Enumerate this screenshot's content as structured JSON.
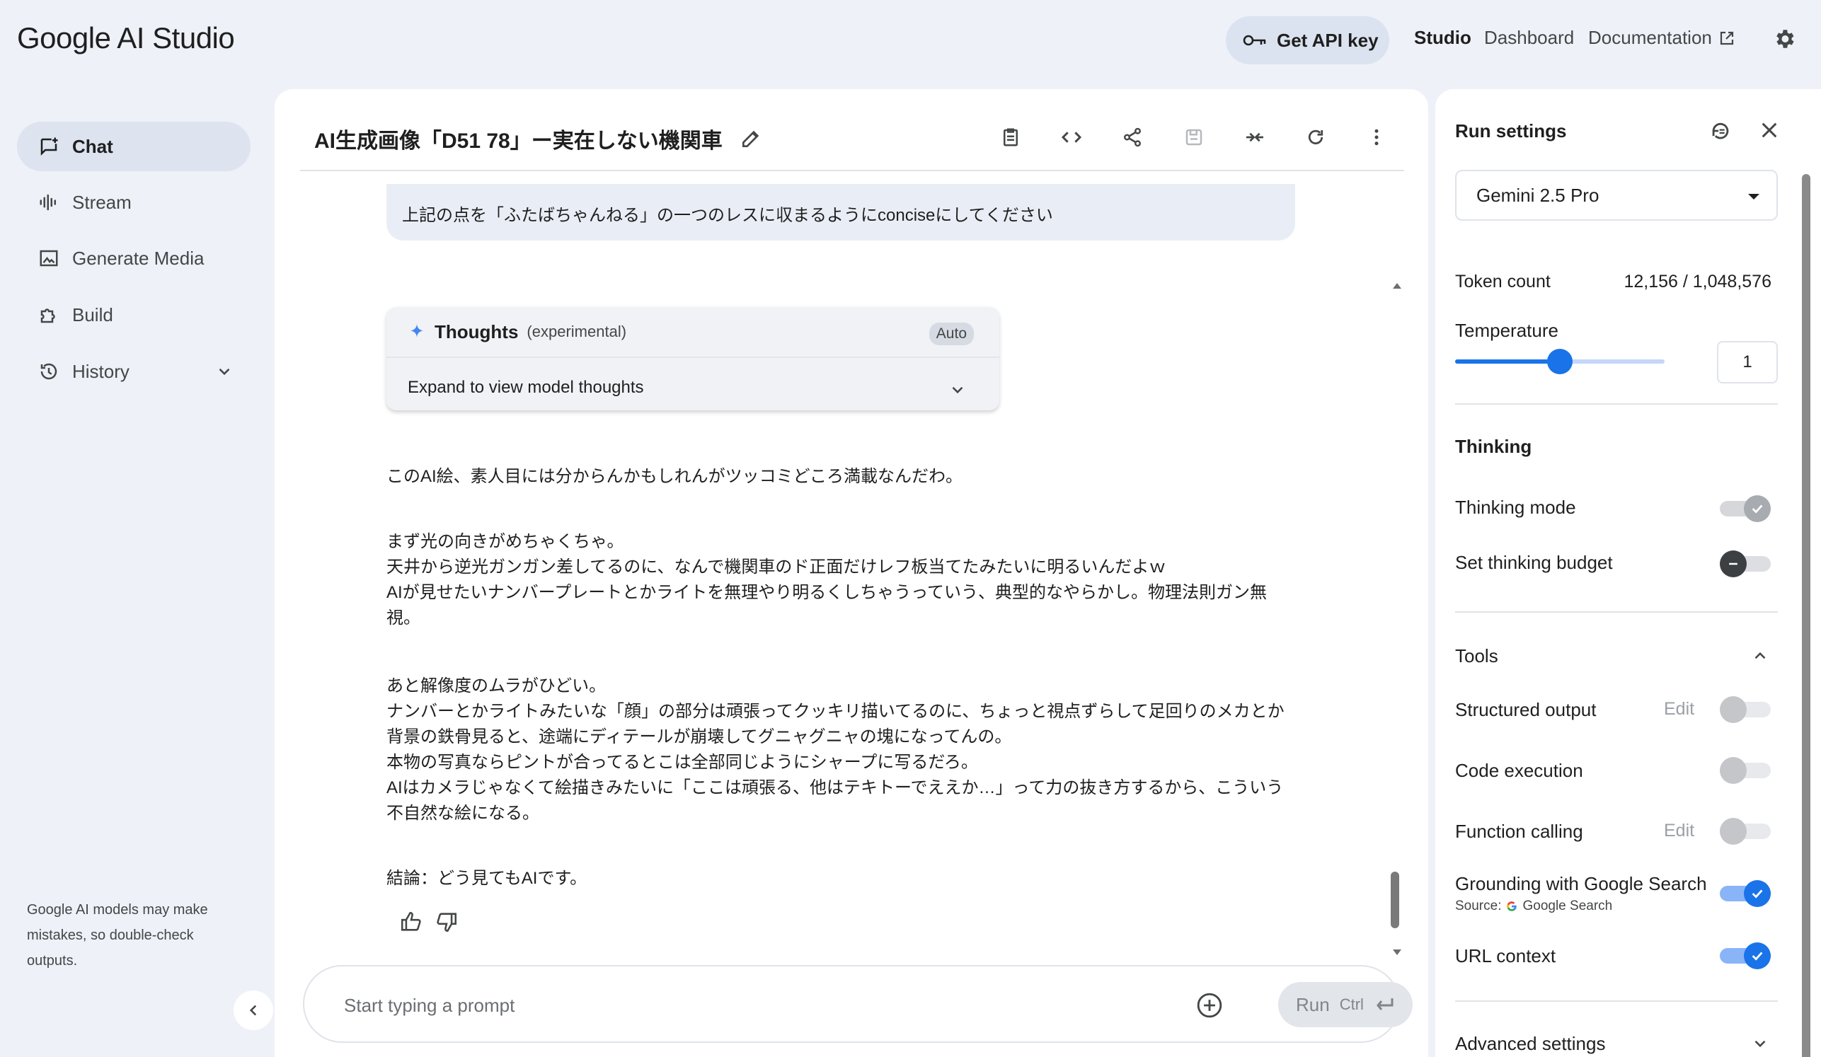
{
  "header": {
    "logo_google": "Google",
    "logo_product": "AI Studio",
    "get_api_key": "Get API key",
    "nav": [
      "Studio",
      "Dashboard",
      "Documentation"
    ]
  },
  "sidebar": {
    "items": [
      {
        "label": "Chat",
        "icon": "chat-icon",
        "active": true
      },
      {
        "label": "Stream",
        "icon": "stream-icon",
        "active": false
      },
      {
        "label": "Generate Media",
        "icon": "image-icon",
        "active": false
      },
      {
        "label": "Build",
        "icon": "puzzle-icon",
        "active": false
      },
      {
        "label": "History",
        "icon": "history-icon",
        "active": false
      }
    ],
    "disclaimer": "Google AI models may make mistakes, so double-check outputs."
  },
  "chat": {
    "title": "AI生成画像「D51 78」ー実在しない機関車",
    "user_message": "上記の点を「ふたばちゃんねる」の一つのレスに収まるようにconciseにしてください",
    "thoughts": {
      "title": "Thoughts",
      "subtitle": "(experimental)",
      "badge": "Auto",
      "expand_label": "Expand to view model thoughts"
    },
    "response_paragraphs": [
      "このAI絵、素人目には分からんかもしれんがツッコミどころ満載なんだわ。",
      "まず光の向きがめちゃくちゃ。\n天井から逆光ガンガン差してるのに、なんで機関車のド正面だけレフ板当てたみたいに明るいんだよｗ\nAIが見せたいナンバープレートとかライトを無理やり明るくしちゃうっていう、典型的なやらかし。物理法則ガン無視。",
      "あと解像度のムラがひどい。\nナンバーとかライトみたいな「顔」の部分は頑張ってクッキリ描いてるのに、ちょっと視点ずらして足回りのメカとか背景の鉄骨見ると、途端にディテールが崩壊してグニャグニャの塊になってんの。\n本物の写真ならピントが合ってるとこは全部同じようにシャープに写るだろ。\nAIはカメラじゃなくて絵描きみたいに「ここは頑張る、他はテキトーでええか…」って力の抜き方するから、こういう不自然な絵になる。",
      "結論：どう見てもAIです。"
    ],
    "prompt_placeholder": "Start typing a prompt",
    "run_label": "Run",
    "run_shortcut": "Ctrl"
  },
  "run_settings": {
    "title": "Run settings",
    "model": "Gemini 2.5 Pro",
    "token_count_label": "Token count",
    "token_count_value": "12,156 / 1,048,576",
    "temperature_label": "Temperature",
    "temperature_value": "1",
    "temperature_fraction": 0.5,
    "thinking_heading": "Thinking",
    "thinking_mode_label": "Thinking mode",
    "thinking_mode_on": true,
    "thinking_budget_label": "Set thinking budget",
    "thinking_budget_on": false,
    "tools_heading": "Tools",
    "edit_label": "Edit",
    "structured_output_label": "Structured output",
    "structured_output_on": false,
    "code_execution_label": "Code execution",
    "code_execution_on": false,
    "function_calling_label": "Function calling",
    "function_calling_on": false,
    "grounding_label": "Grounding with Google Search",
    "grounding_source_prefix": "Source:",
    "grounding_source": "Google Search",
    "grounding_on": true,
    "url_context_label": "URL context",
    "url_context_on": true,
    "advanced_label": "Advanced settings"
  },
  "colors": {
    "accent": "#1a73e8",
    "page_bg": "#eef1f8",
    "active_nav_bg": "#dde3ef"
  }
}
